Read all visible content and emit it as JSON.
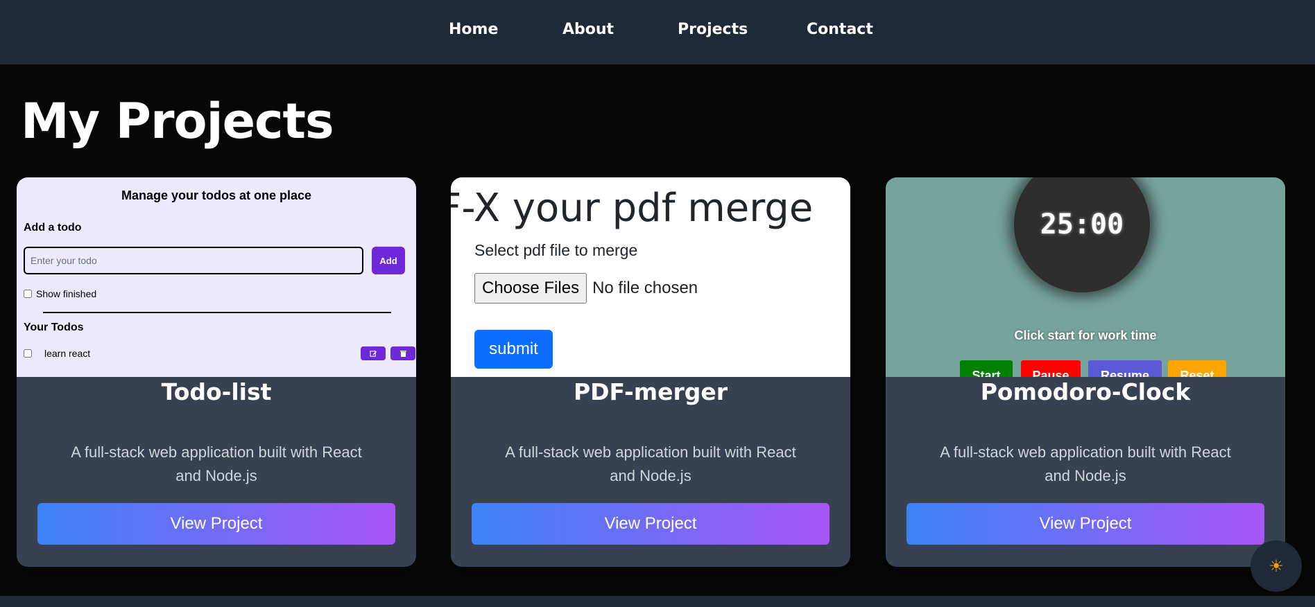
{
  "nav": {
    "items": [
      "Home",
      "About",
      "Projects",
      "Contact"
    ]
  },
  "page": {
    "title": "My Projects"
  },
  "projects": [
    {
      "title": "Todo-list",
      "description": "A full-stack web application built with React and Node.js",
      "button_label": "View Project",
      "preview": {
        "heading": "Manage your todos at one place",
        "add_label": "Add a todo",
        "input_placeholder": "Enter your todo",
        "add_button": "Add",
        "show_finished": "Show finished",
        "list_heading": "Your Todos",
        "items": [
          "learn react"
        ]
      }
    },
    {
      "title": "PDF-merger",
      "description": "A full-stack web application built with React and Node.js",
      "button_label": "View Project",
      "preview": {
        "heading": "DF-X your pdf merge",
        "select_label": "Select pdf file to merge",
        "choose_button": "Choose Files",
        "file_status": "No file chosen",
        "submit_button": "submit"
      }
    },
    {
      "title": "Pomodoro-Clock",
      "description": "A full-stack web application built with React and Node.js",
      "button_label": "View Project",
      "preview": {
        "time": "25:00",
        "hint": "Click start for work time",
        "buttons": [
          "Start",
          "Pause",
          "Resume",
          "Reset"
        ]
      }
    }
  ],
  "theme_toggle": {
    "icon": "sun-icon"
  },
  "colors": {
    "background": "#070707",
    "navbar": "#1f2937",
    "card": "#374151",
    "button_gradient_start": "#3b82f6",
    "button_gradient_end": "#a855f7"
  }
}
